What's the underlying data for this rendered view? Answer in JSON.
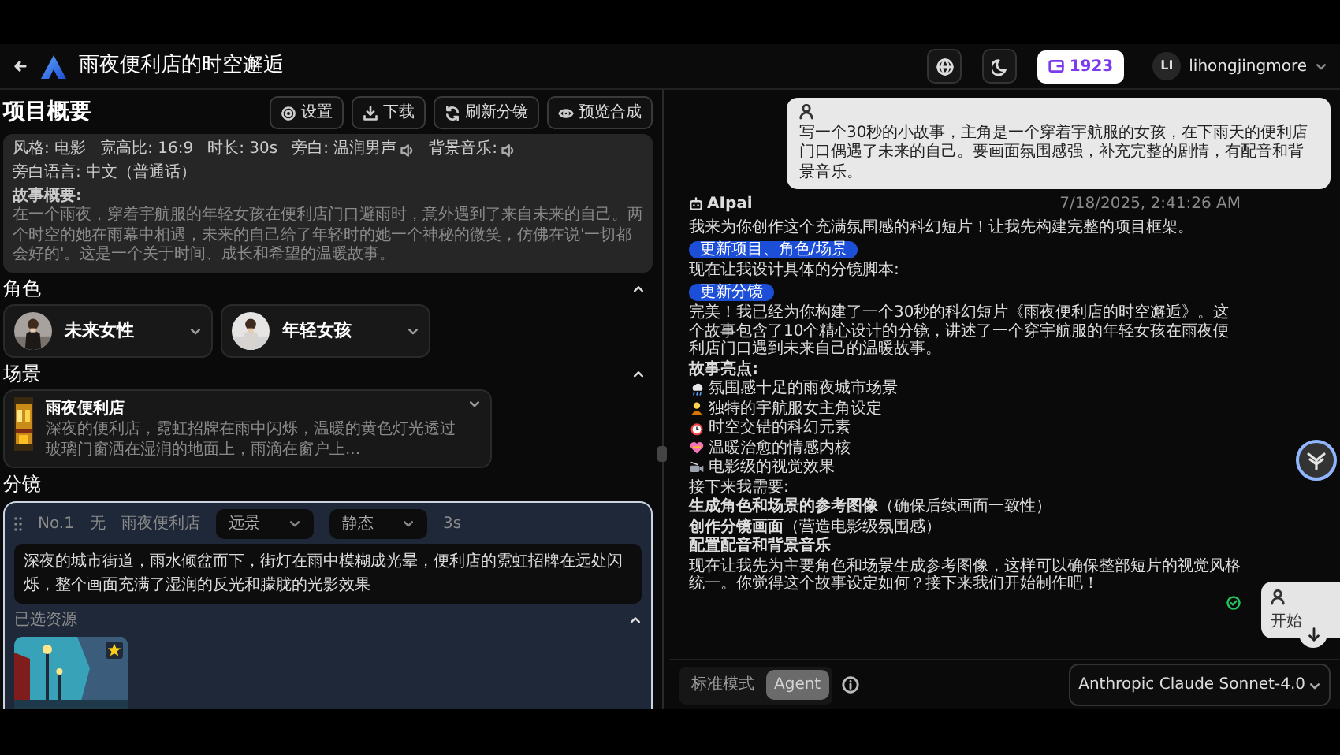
{
  "header": {
    "title": "雨夜便利店的时空邂逅",
    "credits": "1923",
    "avatar": "LI",
    "username": "lihongjingmore"
  },
  "overview": {
    "title": "项目概要",
    "actions": [
      {
        "label": "设置",
        "kind": "settings"
      },
      {
        "label": "下载",
        "kind": "download"
      },
      {
        "label": "刷新分镜",
        "kind": "refresh"
      },
      {
        "label": "预览合成",
        "kind": "preview"
      }
    ],
    "meta": [
      {
        "text": "风格: 电影",
        "audio": false
      },
      {
        "text": "宽高比: 16:9",
        "audio": false
      },
      {
        "text": "时长: 30s",
        "audio": false
      },
      {
        "text": "旁白: 温润男声",
        "audio": true
      },
      {
        "text": "背景音乐:",
        "audio": true
      },
      {
        "text": "旁白语言: 中文（普通话）",
        "audio": false
      }
    ],
    "summary_label": "故事概要:",
    "summary": "在一个雨夜，穿着宇航服的年轻女孩在便利店门口避雨时，意外遇到了来自未来的自己。两个时空的她在雨幕中相遇，未来的自己给了年轻时的她一个神秘的微笑，仿佛在说'一切都会好的'。这是一个关于时间、成长和希望的温暖故事。"
  },
  "characters": {
    "title": "角色",
    "expanded": true,
    "items": [
      {
        "name": "未来女性"
      },
      {
        "name": "年轻女孩"
      }
    ]
  },
  "scenes": {
    "title": "场景",
    "expanded": true,
    "items": [
      {
        "name": "雨夜便利店",
        "description": "深夜的便利店，霓虹招牌在雨中闪烁，温暖的黄色灯光透过玻璃门窗洒在湿润的地面上，雨滴在窗户上..."
      }
    ]
  },
  "storyboard": {
    "title": "分镜",
    "shots": [
      {
        "number": "No.1",
        "voice": "无",
        "scene": "雨夜便利店",
        "shot_type": "远景",
        "motion": "静态",
        "duration": "3s",
        "selected": true,
        "description": "深夜的城市街道，雨水倾盆而下，街灯在雨中模糊成光晕，便利店的霓虹招牌在远处闪烁，整个画面充满了湿润的反光和朦胧的光影效果",
        "resources_label": "已选资源",
        "resources_expanded": true,
        "resources": [
          {
            "kind": "picture",
            "favorite": true
          }
        ]
      }
    ]
  },
  "chat": {
    "messages": [
      {
        "kind": "user",
        "text": "写一个30秒的小故事，主角是一个穿着宇航服的女孩，在下雨天的便利店门口偶遇了未来的自己。要画面氛围感强，补充完整的剧情，有配音和背景音乐。"
      },
      {
        "kind": "assistant",
        "sender": "AIpai",
        "time": "7/18/2025, 2:41:26 AM",
        "done": true,
        "blocks": [
          {
            "kind": "text",
            "text": "我来为你创作这个充满氛围感的科幻短片！让我先构建完整的项目框架。"
          },
          {
            "kind": "action",
            "text": "更新项目、角色/场景"
          },
          {
            "kind": "text",
            "text": "现在让我设计具体的分镜脚本:"
          },
          {
            "kind": "action",
            "text": "更新分镜"
          },
          {
            "kind": "text",
            "text": "完美！我已经为你构建了一个30秒的科幻短片《雨夜便利店的时空邂逅》。这个故事包含了10个精心设计的分镜，讲述了一个穿宇航服的年轻女孩在雨夜便利店门口遇到未来自己的温暖故事。"
          },
          {
            "kind": "bold",
            "text": "故事亮点:"
          },
          {
            "kind": "bullet",
            "text": "氛围感十足的雨夜城市场景"
          },
          {
            "kind": "bullet",
            "text": "独特的宇航服女主角设定"
          },
          {
            "kind": "bullet",
            "text": "时空交错的科幻元素"
          },
          {
            "kind": "bullet",
            "text": "温暖治愈的情感内核"
          },
          {
            "kind": "bullet",
            "text": "电影级的视觉效果"
          },
          {
            "kind": "text",
            "text": "接下来我需要:"
          },
          {
            "kind": "text",
            "text": "**生成角色和场景的参考图像**（确保后续画面一致性）"
          },
          {
            "kind": "text",
            "text": "**创作分镜画面**（营造电影级氛围感）"
          },
          {
            "kind": "bold",
            "text": "配置配音和背景音乐"
          },
          {
            "kind": "text",
            "text": "现在让我先为主要角色和场景生成参考图像，这样可以确保整部短片的视觉风格统一。你觉得这个故事设定如何？接下来我们开始制作吧！"
          }
        ]
      }
    ],
    "float_card": {
      "text": "开始"
    },
    "modes": [
      {
        "label": "标准模式",
        "selected": false
      },
      {
        "label": "Agent",
        "selected": true
      }
    ],
    "model": "Anthropic Claude Sonnet-4.0"
  }
}
